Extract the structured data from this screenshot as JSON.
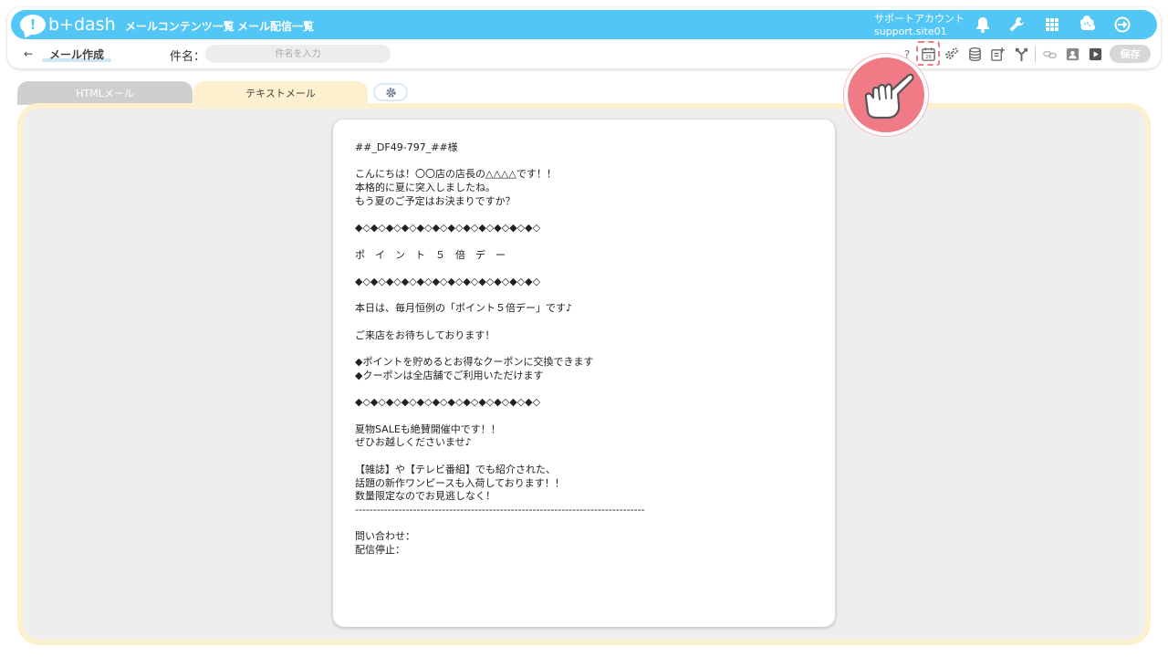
{
  "app": {
    "logo_text": "b+dash"
  },
  "nav": {
    "links": [
      "メールコンテンツ一覧",
      "メール配信一覧"
    ]
  },
  "account": {
    "name": "サポートアカウント",
    "site": "support.site01"
  },
  "page": {
    "back": "←",
    "title": "メール作成",
    "subject_label": "件名：",
    "subject_placeholder": "件名を入力",
    "subject_value": "",
    "save_label": "保存",
    "calendar_day": "28"
  },
  "tabs": [
    {
      "label": "HTMLメール",
      "active": false
    },
    {
      "label": "テキストメール",
      "active": true
    }
  ],
  "icons": {
    "top": [
      "bell-icon",
      "wrench-icon",
      "grid-icon",
      "brain-icon",
      "logout-icon"
    ],
    "toolbar": [
      "help-icon",
      "calendar-icon",
      "gears-icon",
      "database-icon",
      "add-document-icon",
      "merge-icon",
      "link-icon",
      "contact-card-icon",
      "play-icon"
    ]
  },
  "mail": {
    "body": "##_DF49-797_##様\n\nこんにちは！〇〇店の店長の△△△△です！！\n本格的に夏に突入しましたね。\nもう夏のご予定はお決まりですか？\n\n◆◇◆◇◆◇◆◇◆◇◆◇◆◇◆◇◆◇◆◇◆◇◆◇\n\nポ　イ　ン　ト　５　倍　デ　ー\n\n◆◇◆◇◆◇◆◇◆◇◆◇◆◇◆◇◆◇◆◇◆◇◆◇\n\n本日は、毎月恒例の「ポイント５倍デー」です♪\n\nご来店をお待ちしております！\n\n◆ポイントを貯めるとお得なクーポンに交換できます\n◆クーポンは全店舗でご利用いただけます\n\n◆◇◆◇◆◇◆◇◆◇◆◇◆◇◆◇◆◇◆◇◆◇◆◇\n\n夏物SALEも絶賛開催中です！！\nぜひお越しくださいませ♪\n\n【雑誌】や【テレビ番組】でも紹介された、\n話題の新作ワンピースも入荷しております！！\n数量限定なのでお見逃しなく！\n--------------------------------------------------------------------------------\n\n問い合わせ：\n配信停止："
  },
  "colors": {
    "header_blue": "#52c6f5",
    "tab_active": "#fdf0cf",
    "tab_inactive": "#cfcfcf",
    "highlight_pink": "#f07a85"
  }
}
